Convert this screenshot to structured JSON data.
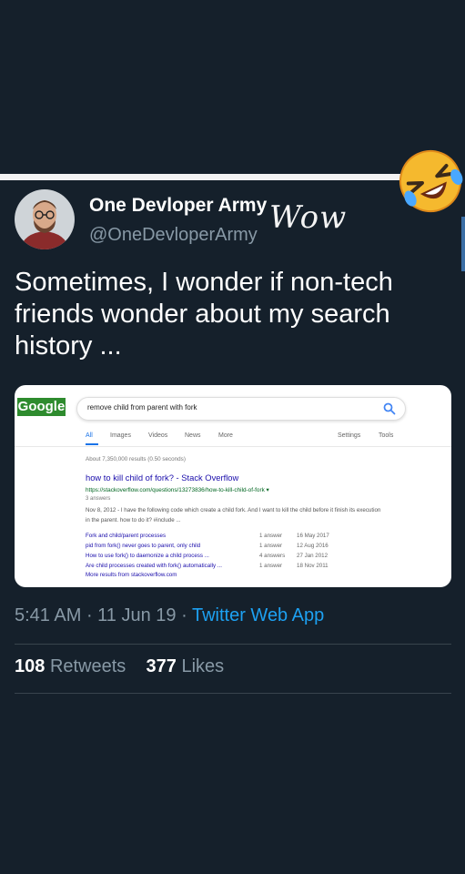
{
  "overlay": {
    "wow_text": "Wow",
    "emoji_icon": "laughing-face-emoji-icon"
  },
  "tweet": {
    "display_name": "One Devloper Army",
    "handle": "@OneDevloperArmy",
    "text": "Sometimes, I wonder if non-tech friends wonder about my search history ...",
    "time": "5:41 AM",
    "date": "11 Jun 19",
    "source": "Twitter Web App",
    "retweets": "108",
    "retweets_label": "Retweets",
    "likes": "377",
    "likes_label": "Likes"
  },
  "search": {
    "logo": "Google",
    "query": "remove child from parent with fork",
    "tabs": [
      "All",
      "Images",
      "Videos",
      "News",
      "More"
    ],
    "settings_label": "Settings",
    "tools_label": "Tools",
    "stats": "About 7,350,000 results (0.50 seconds)",
    "result": {
      "title": "how to kill child of fork? - Stack Overflow",
      "url": "https://stackoverflow.com/questions/13273836/how-to-kill-child-of-fork ▾",
      "answers": "3 answers",
      "snippet": "Nov 8, 2012 - I have the following code which create a child fork. And I want to kill the child before it finish its execution in the parent. how to do it? #include ..."
    },
    "sub_results": [
      {
        "title": "Fork and child/parent processes",
        "answers": "1 answer",
        "date": "16 May 2017"
      },
      {
        "title": "pid from fork() never goes to parent, only child",
        "answers": "1 answer",
        "date": "12 Aug 2016"
      },
      {
        "title": "How to use fork() to daemonize a child process ...",
        "answers": "4 answers",
        "date": "27 Jan 2012"
      },
      {
        "title": "Are child processes created with fork() automatically ...",
        "answers": "1 answer",
        "date": "18 Nov 2011"
      }
    ],
    "more_results": "More results from stackoverflow.com"
  },
  "colors": {
    "background": "#15202b",
    "accent": "#1da1f2",
    "secondary_text": "#8899a6",
    "link": "#1a0dab",
    "url_green": "#006621"
  }
}
